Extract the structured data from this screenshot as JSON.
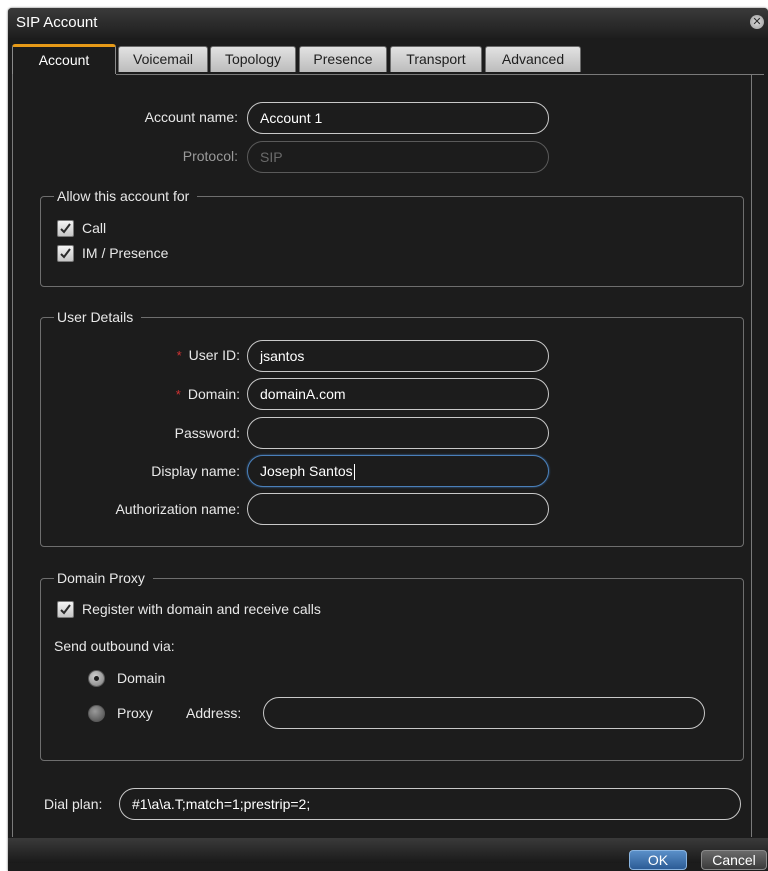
{
  "window": {
    "title": "SIP Account"
  },
  "tabs": [
    {
      "label": "Account",
      "active": true
    },
    {
      "label": "Voicemail"
    },
    {
      "label": "Topology"
    },
    {
      "label": "Presence"
    },
    {
      "label": "Transport"
    },
    {
      "label": "Advanced"
    }
  ],
  "account": {
    "name_label": "Account name:",
    "name_value": "Account 1",
    "protocol_label": "Protocol:",
    "protocol_value": "SIP"
  },
  "allow_group": {
    "legend": "Allow this account for",
    "call_label": "Call",
    "call_checked": true,
    "im_label": "IM / Presence",
    "im_checked": true
  },
  "user_details": {
    "legend": "User Details",
    "required_marker": "*",
    "user_id_label": "User ID:",
    "user_id_value": "jsantos",
    "domain_label": "Domain:",
    "domain_value": "domainA.com",
    "password_label": "Password:",
    "password_value": "",
    "display_name_label": "Display name:",
    "display_name_value": "Joseph Santos",
    "auth_name_label": "Authorization name:",
    "auth_name_value": ""
  },
  "domain_proxy": {
    "legend": "Domain Proxy",
    "register_label": "Register with domain and receive calls",
    "register_checked": true,
    "send_outbound_label": "Send outbound via:",
    "domain_radio_label": "Domain",
    "proxy_radio_label": "Proxy",
    "selected": "Domain",
    "address_label": "Address:",
    "address_value": ""
  },
  "dial_plan": {
    "label": "Dial plan:",
    "value": "#1\\a\\a.T;match=1;prestrip=2;"
  },
  "footer": {
    "ok_label": "OK",
    "cancel_label": "Cancel"
  },
  "colors": {
    "background": "#1c1c1c",
    "active_tab_accent": "#e69a18",
    "required_marker": "#d23232",
    "ok_button": "#2c5c96"
  }
}
